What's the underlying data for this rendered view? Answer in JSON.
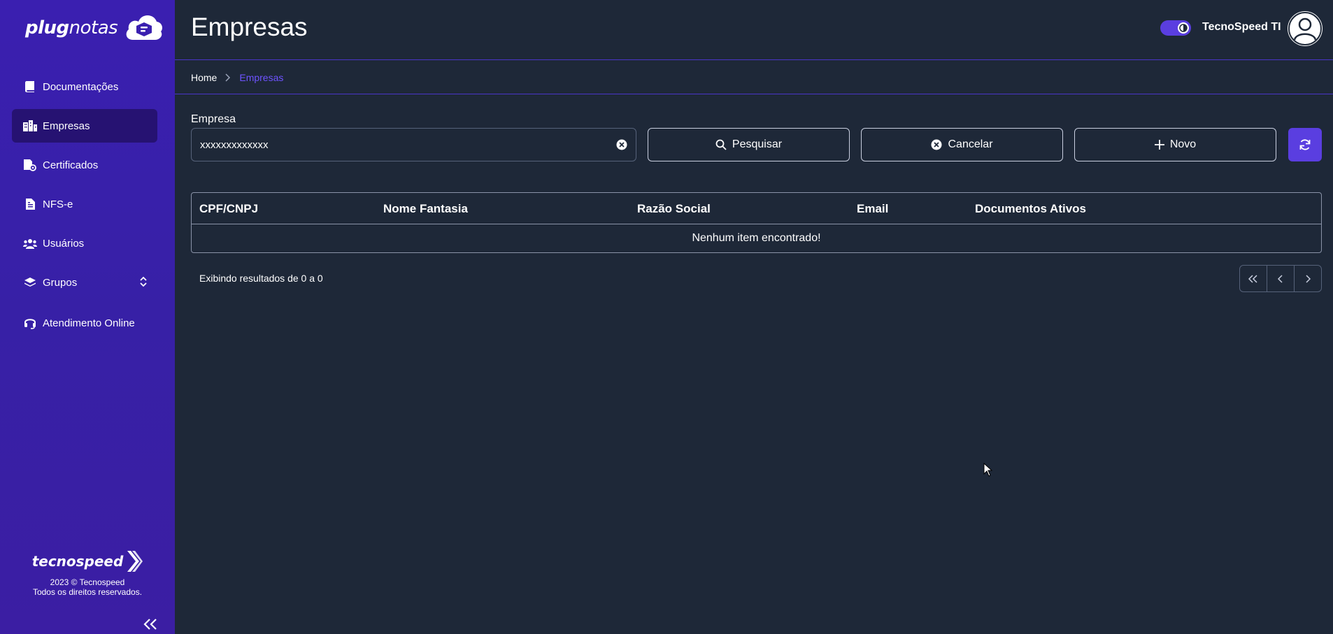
{
  "sidebar": {
    "logo": {
      "part1": "plug",
      "part2": "notas"
    },
    "items": [
      {
        "label": "Documentações",
        "icon": "book-icon"
      },
      {
        "label": "Empresas",
        "icon": "building-icon",
        "active": true
      },
      {
        "label": "Certificados",
        "icon": "certificate-icon"
      },
      {
        "label": "NFS-e",
        "icon": "document-icon"
      },
      {
        "label": "Usuários",
        "icon": "users-icon"
      },
      {
        "label": "Grupos",
        "icon": "layers-icon"
      },
      {
        "label": "Atendimento Online",
        "icon": "headset-icon"
      }
    ],
    "footer": {
      "brand": "tecnospeed",
      "copyright_line1": "2023 © Tecnospeed",
      "copyright_line2": "Todos os direitos reservados."
    }
  },
  "header": {
    "title": "Empresas",
    "user_name": "TecnoSpeed TI"
  },
  "breadcrumb": {
    "home": "Home",
    "current": "Empresas"
  },
  "filter": {
    "label": "Empresa",
    "value": "xxxxxxxxxxxxx",
    "search_label": "Pesquisar",
    "cancel_label": "Cancelar",
    "new_label": "Novo"
  },
  "table": {
    "columns": [
      "CPF/CNPJ",
      "Nome Fantasia",
      "Razão Social",
      "Email",
      "Documentos Ativos"
    ],
    "empty_message": "Nenhum item encontrado!"
  },
  "pagination": {
    "summary": "Exibindo resultados de 0 a 0"
  },
  "colors": {
    "accent": "#5a3ee0",
    "sidebar": "#3a1fb0",
    "background": "#1e2838",
    "breadcrumb_active": "#6e53ff"
  }
}
